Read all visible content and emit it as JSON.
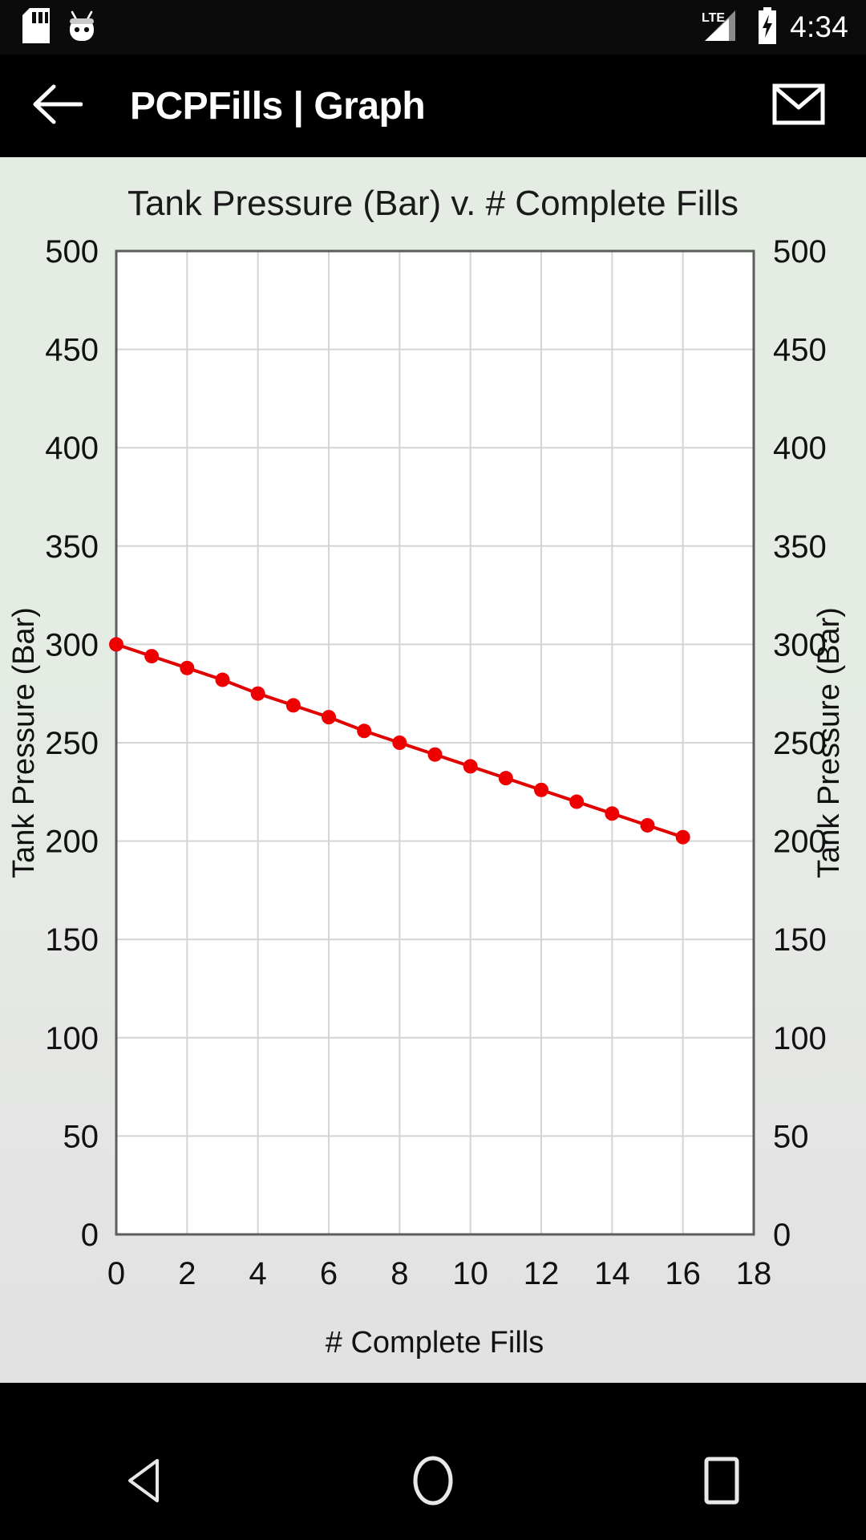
{
  "status_bar": {
    "icons_left": [
      "sd-card-icon",
      "android-marshmallow-icon"
    ],
    "network_type": "LTE",
    "icons_right": [
      "signal-bars-icon",
      "battery-charging-icon"
    ],
    "time": "4:34"
  },
  "app_bar": {
    "back_icon": "arrow-left-icon",
    "title": "PCPFills | Graph",
    "action_icon": "mail-icon"
  },
  "nav_bar": {
    "back": "back-triangle-icon",
    "home": "home-circle-icon",
    "recents": "recents-square-icon"
  },
  "colors": {
    "series": "#e00000",
    "marker": "#ee0000",
    "plot_bg": "#ffffff",
    "grid": "#d4d4d4",
    "frame": "#5a5f5a",
    "page_top": "#e4ece3",
    "page_bottom": "#e2e2e2",
    "app_bar": "#000000",
    "status_bar": "#0b0b0b"
  },
  "chart_data": {
    "type": "line",
    "title": "Tank Pressure (Bar) v. # Complete Fills",
    "xlabel": "# Complete Fills",
    "ylabel": "Tank Pressure (Bar)",
    "ylabel_right": "Tank Pressure (Bar)",
    "xlim": [
      0,
      18
    ],
    "ylim": [
      0,
      500
    ],
    "xticks": [
      0,
      2,
      4,
      6,
      8,
      10,
      12,
      14,
      16,
      18
    ],
    "yticks": [
      0,
      50,
      100,
      150,
      200,
      250,
      300,
      350,
      400,
      450,
      500
    ],
    "xticklabels": [
      "0",
      "2",
      "4",
      "6",
      "8",
      "10",
      "12",
      "14",
      "16",
      "18"
    ],
    "yticklabels": [
      "0",
      "50",
      "100",
      "150",
      "200",
      "250",
      "300",
      "350",
      "400",
      "450",
      "500"
    ],
    "grid": true,
    "legend": false,
    "dual_y_axis": true,
    "x": [
      0,
      1,
      2,
      3,
      4,
      5,
      6,
      7,
      8,
      9,
      10,
      11,
      12,
      13,
      14,
      15,
      16
    ],
    "values": [
      300,
      294,
      288,
      282,
      275,
      269,
      263,
      256,
      250,
      244,
      238,
      232,
      226,
      220,
      214,
      208,
      202
    ],
    "series": [
      {
        "name": "Tank Pressure",
        "values": [
          300,
          294,
          288,
          282,
          275,
          269,
          263,
          256,
          250,
          244,
          238,
          232,
          226,
          220,
          214,
          208,
          202
        ]
      }
    ]
  }
}
